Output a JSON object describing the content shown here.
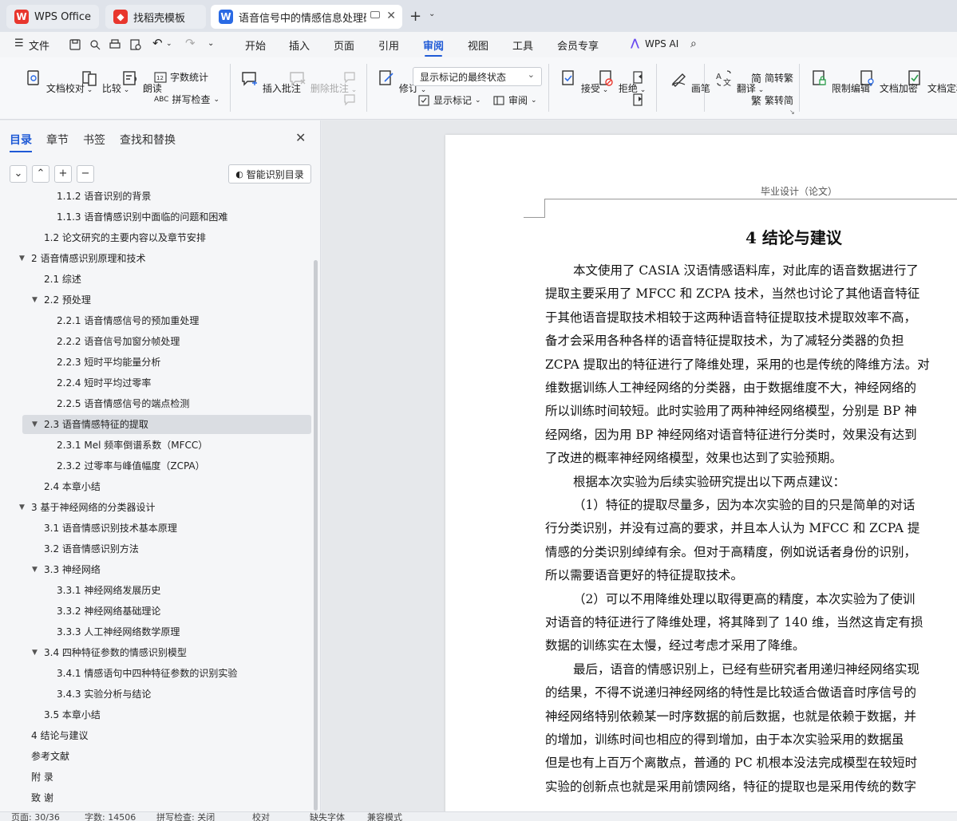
{
  "tabs": [
    {
      "label": "WPS Office",
      "logo": "W",
      "logo_color": "#e8362d"
    },
    {
      "label": "找稻壳模板",
      "logo": "◆",
      "logo_color": "#e8362d"
    },
    {
      "label": "语音信号中的情感信息处理研究",
      "logo": "W",
      "logo_color": "#2a6ae4"
    }
  ],
  "menu": {
    "file": "文件",
    "items": [
      "开始",
      "插入",
      "页面",
      "引用",
      "审阅",
      "视图",
      "工具",
      "会员专享"
    ],
    "active": "审阅",
    "wps_ai": "WPS AI"
  },
  "ribbon": {
    "doc_check": "文档校对",
    "compare": "比较",
    "read_aloud": "朗读",
    "word_count": "字数统计",
    "spell_check": "拼写检查",
    "insert_comment": "插入批注",
    "delete_comment": "删除批注",
    "revise": "修订",
    "markup_state": "显示标记的最终状态",
    "show_markup": "显示标记",
    "review_pane": "审阅",
    "accept": "接受",
    "reject": "拒绝",
    "pen": "画笔",
    "translate": "翻译",
    "to_traditional": "简转繁",
    "to_simplified": "繁转简",
    "restrict_edit": "限制编辑",
    "encrypt": "文档加密",
    "finalize": "文档定稿"
  },
  "panel": {
    "tabs": [
      "目录",
      "章节",
      "书签",
      "查找和替换"
    ],
    "smart_toc": "智能识别目录",
    "toc": [
      {
        "text": "1.1.2 语音识别的背景",
        "level": 3,
        "arrow": ""
      },
      {
        "text": "1.1.3 语音情感识别中面临的问题和困难",
        "level": 3,
        "arrow": ""
      },
      {
        "text": "1.2 论文研究的主要内容以及章节安排",
        "level": 2,
        "arrow": ""
      },
      {
        "text": "2  语音情感识别原理和技术",
        "level": 1,
        "arrow": "▼"
      },
      {
        "text": "2.1 综述",
        "level": 2,
        "arrow": ""
      },
      {
        "text": "2.2  预处理",
        "level": 2,
        "arrow": "▼"
      },
      {
        "text": "2.2.1 语音情感信号的预加重处理",
        "level": 3,
        "arrow": ""
      },
      {
        "text": "2.2.2 语音信号加窗分帧处理",
        "level": 3,
        "arrow": ""
      },
      {
        "text": "2.2.3  短时平均能量分析",
        "level": 3,
        "arrow": ""
      },
      {
        "text": "2.2.4  短时平均过零率",
        "level": 3,
        "arrow": ""
      },
      {
        "text": "2.2.5  语音情感信号的端点检测",
        "level": 3,
        "arrow": ""
      },
      {
        "text": "2.3 语音情感特征的提取",
        "level": 2,
        "arrow": "▼",
        "selected": true
      },
      {
        "text": "2.3.1 Mel 频率倒谱系数（MFCC）",
        "level": 3,
        "arrow": ""
      },
      {
        "text": "2.3.2 过零率与峰值幅度（ZCPA）",
        "level": 3,
        "arrow": ""
      },
      {
        "text": "2.4 本章小结",
        "level": 2,
        "arrow": ""
      },
      {
        "text": "3  基于神经网络的分类器设计",
        "level": 1,
        "arrow": "▼"
      },
      {
        "text": "3.1  语音情感识别技术基本原理",
        "level": 2,
        "arrow": ""
      },
      {
        "text": "3.2 语音情感识别方法",
        "level": 2,
        "arrow": ""
      },
      {
        "text": "3.3 神经网络",
        "level": 2,
        "arrow": "▼"
      },
      {
        "text": "3.3.1 神经网络发展历史",
        "level": 3,
        "arrow": ""
      },
      {
        "text": "3.3.2 神经网络基础理论",
        "level": 3,
        "arrow": ""
      },
      {
        "text": "3.3.3 人工神经网络数学原理",
        "level": 3,
        "arrow": ""
      },
      {
        "text": "3.4 四种特征参数的情感识别模型",
        "level": 2,
        "arrow": "▼"
      },
      {
        "text": "3.4.1 情感语句中四种特征参数的识别实验",
        "level": 3,
        "arrow": ""
      },
      {
        "text": "3.4.3 实验分析与结论",
        "level": 3,
        "arrow": ""
      },
      {
        "text": "3.5 本章小结",
        "level": 2,
        "arrow": ""
      },
      {
        "text": "4  结论与建议",
        "level": 1,
        "arrow": ""
      },
      {
        "text": "参考文献",
        "level": 1,
        "arrow": ""
      },
      {
        "text": "附  录",
        "level": 1,
        "arrow": ""
      },
      {
        "text": "致  谢",
        "level": 1,
        "arrow": ""
      }
    ]
  },
  "document": {
    "header": "毕业设计（论文）",
    "title": "4  结论与建议",
    "lines": [
      {
        "text": "本文使用了 CASIA 汉语情感语料库，对此库的语音数据进行了",
        "indent": true
      },
      {
        "text": "提取主要采用了 MFCC 和 ZCPA 技术，当然也讨论了其他语音特征",
        "indent": false
      },
      {
        "text": "于其他语音提取技术相较于这两种语音特征提取技术提取效率不高，",
        "indent": false
      },
      {
        "text": "备才会采用各种各样的语音特征提取技术，为了减轻分类器的负担",
        "indent": false
      },
      {
        "text": "ZCPA 提取出的特征进行了降维处理，采用的也是传统的降维方法。对",
        "indent": false
      },
      {
        "text": "维数据训练人工神经网络的分类器，由于数据维度不大，神经网络的",
        "indent": false
      },
      {
        "text": "所以训练时间较短。此时实验用了两种神经网络模型，分别是 BP 神",
        "indent": false
      },
      {
        "text": "经网络，因为用 BP 神经网络对语音特征进行分类时，效果没有达到",
        "indent": false
      },
      {
        "text": "了改进的概率神经网络模型，效果也达到了实验预期。",
        "indent": false
      },
      {
        "text": "根据本次实验为后续实验研究提出以下两点建议：",
        "indent": true
      },
      {
        "text": "（1）特征的提取尽量多，因为本次实验的目的只是简单的对话",
        "indent": true
      },
      {
        "text": "行分类识别，并没有过高的要求，并且本人认为 MFCC 和 ZCPA 提",
        "indent": false
      },
      {
        "text": "情感的分类识别绰绰有余。但对于高精度，例如说话者身份的识别，",
        "indent": false
      },
      {
        "text": "所以需要语音更好的特征提取技术。",
        "indent": false
      },
      {
        "text": "（2）可以不用降维处理以取得更高的精度，本次实验为了使训",
        "indent": true
      },
      {
        "text": "对语音的特征进行了降维处理，将其降到了 140 维，当然这肯定有损",
        "indent": false
      },
      {
        "text": "数据的训练实在太慢，经过考虑才采用了降维。",
        "indent": false
      },
      {
        "text": "最后，语音的情感识别上，已经有些研究者用递归神经网络实现",
        "indent": true
      },
      {
        "text": "的结果，不得不说递归神经网络的特性是比较适合做语音时序信号的",
        "indent": false
      },
      {
        "text": "神经网络特别依赖某一时序数据的前后数据，也就是依赖于数据，并",
        "indent": false
      },
      {
        "text": "的增加，训练时间也相应的得到增加，由于本次实验采用的数据虽",
        "indent": false
      },
      {
        "text": "但是也有上百万个离散点，普通的 PC 机根本没法完成模型在较短时",
        "indent": false
      },
      {
        "text": "实验的创新点也就是采用前馈网络，特征的提取也是采用传统的数字",
        "indent": false
      }
    ]
  },
  "status": {
    "page": "页面: 30/36",
    "words": "字数: 14506",
    "spell": "拼写检查: 关闭",
    "proof": "校对",
    "missing_font": "缺失字体",
    "compat": "兼容模式"
  }
}
